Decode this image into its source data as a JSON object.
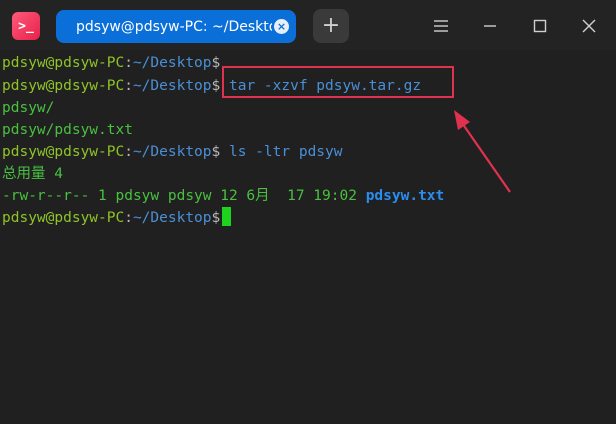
{
  "window": {
    "app_icon_glyph": ">_",
    "tab_title": "pdsyw@pdsyw-PC: ~/Desktop",
    "tab_close_glyph": "×",
    "new_tab_glyph": "+"
  },
  "terminal": {
    "prompt_user": "pdsyw@pdsyw-PC",
    "prompt_colon": ":",
    "prompt_path": "~/Desktop",
    "prompt_dollar": "$",
    "lines": [
      {
        "type": "prompt",
        "command": ""
      },
      {
        "type": "prompt",
        "command": " tar -xzvf pdsyw.tar.gz"
      },
      {
        "type": "output",
        "text": "pdsyw/"
      },
      {
        "type": "output",
        "text": "pdsyw/pdsyw.txt"
      },
      {
        "type": "prompt",
        "command": " ls -ltr pdsyw"
      },
      {
        "type": "output",
        "text": "总用量 4"
      },
      {
        "type": "listing",
        "meta": "-rw-r--r-- 1 pdsyw pdsyw 12 6月  17 19:02 ",
        "file": "pdsyw.txt"
      },
      {
        "type": "prompt",
        "command": " "
      }
    ]
  },
  "annotation": {
    "color": "#e0324f"
  },
  "colors": {
    "tab_active": "#0a6fd8",
    "prompt_user": "#8ec428",
    "prompt_path": "#4a8fd6",
    "output": "#49c040",
    "file": "#2a8df0",
    "cursor": "#1ed31e"
  }
}
